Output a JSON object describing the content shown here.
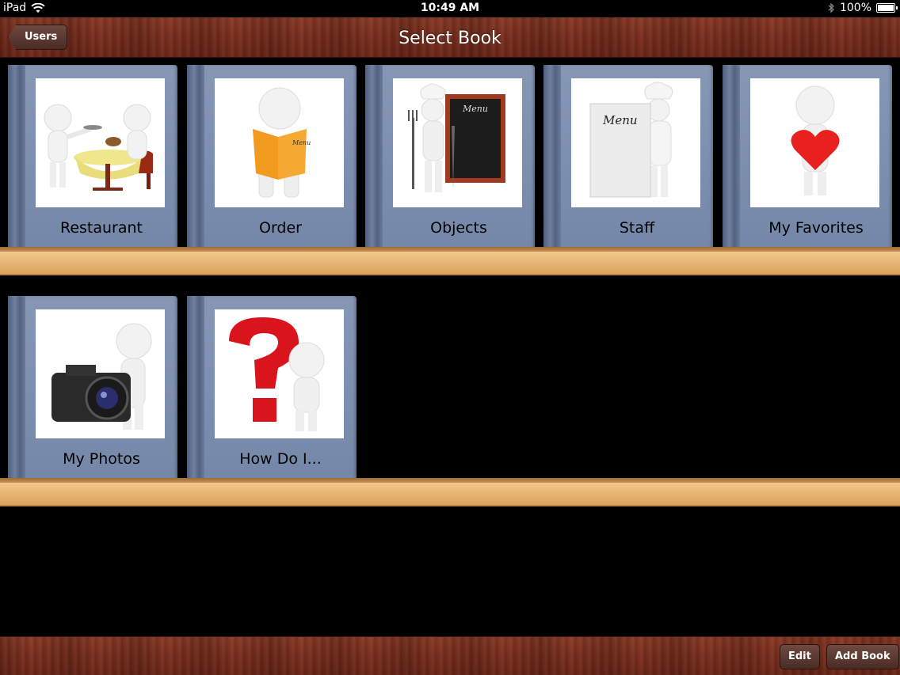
{
  "status_bar": {
    "device": "iPad",
    "time": "10:49 AM",
    "battery": "100%",
    "icons": [
      "wifi-icon",
      "bluetooth-icon",
      "battery-icon"
    ]
  },
  "nav_bar": {
    "title": "Select Book",
    "back_label": "Users"
  },
  "books": [
    {
      "title": "Restaurant",
      "icon": "restaurant-waiter-icon"
    },
    {
      "title": "Order",
      "icon": "menu-reading-icon",
      "image_text": "Menu"
    },
    {
      "title": "Objects",
      "icon": "chef-menu-board-icon",
      "image_text": "Menu"
    },
    {
      "title": "Staff",
      "icon": "chef-menu-sign-icon",
      "image_text": "Menu"
    },
    {
      "title": "My Favorites",
      "icon": "heart-icon"
    },
    {
      "title": "My Photos",
      "icon": "camera-icon"
    },
    {
      "title": "How Do I...",
      "icon": "question-mark-icon"
    }
  ],
  "toolbar": {
    "edit_label": "Edit",
    "add_book_label": "Add Book"
  },
  "colors": {
    "wood": "#7a2e1d",
    "shelf": "#eab877",
    "book_cover": "#7f91b1",
    "heart": "#e8201e",
    "question": "#d9141c",
    "menu_orange": "#f29a1e"
  }
}
